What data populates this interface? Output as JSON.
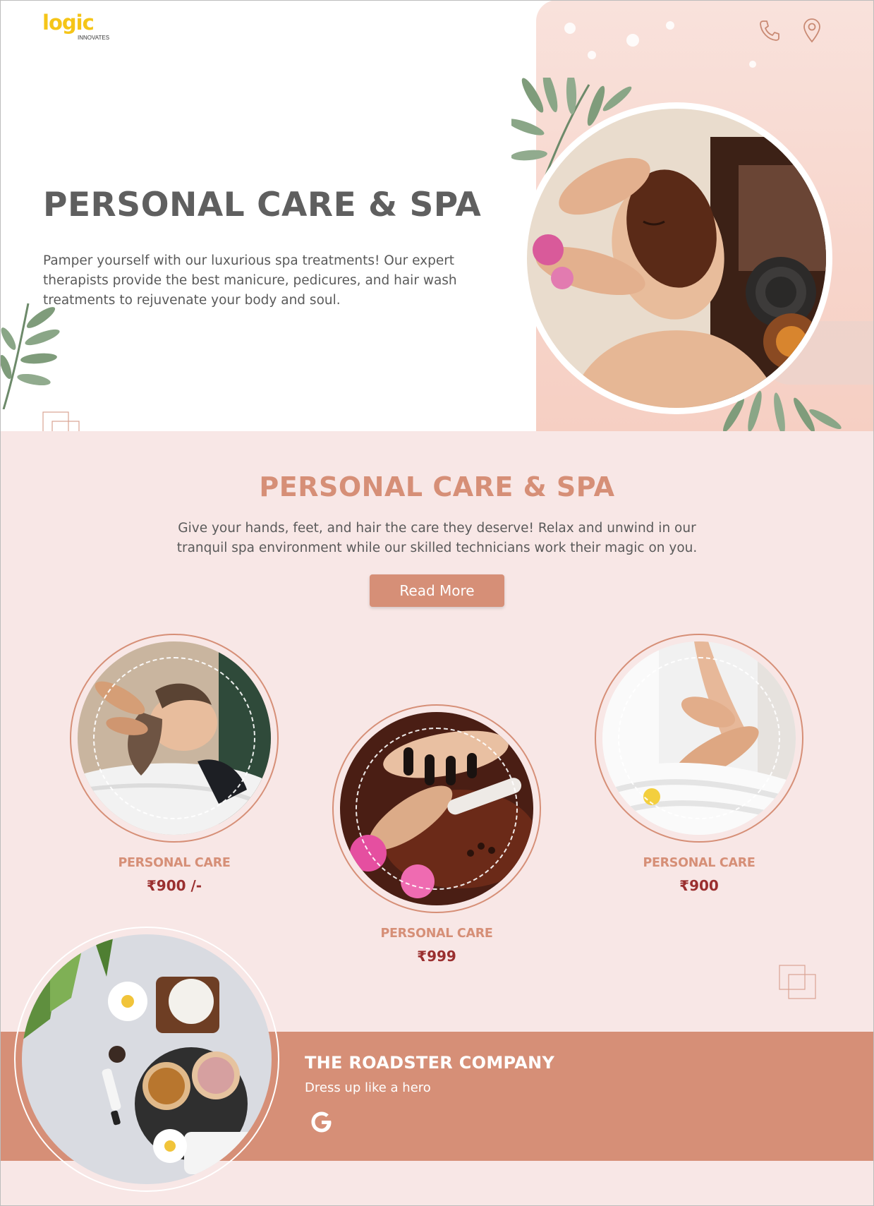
{
  "brand": {
    "logo_text": "logic",
    "logo_sub": "INNOVATES"
  },
  "header": {
    "phone_icon": "phone-icon",
    "location_icon": "map-pin-icon"
  },
  "hero": {
    "title": "PERSONAL CARE & SPA",
    "text": "Pamper yourself with our luxurious spa treatments! Our expert therapists provide the best manicure, pedicures, and hair wash treatments to rejuvenate your body and soul."
  },
  "services": {
    "title": "PERSONAL CARE & SPA",
    "text": "Give your hands, feet, and hair the care they deserve! Relax and unwind in our tranquil spa environment while our skilled technicians work their magic on you.",
    "button_label": "Read More",
    "cards": [
      {
        "label": "PERSONAL CARE",
        "price": "₹900 /-"
      },
      {
        "label": "PERSONAL CARE",
        "price": "₹999"
      },
      {
        "label": "PERSONAL CARE",
        "price": "₹900"
      }
    ]
  },
  "footer": {
    "title": "THE ROADSTER COMPANY",
    "subtitle": "Dress up like a hero",
    "social_icon": "google-icon"
  },
  "colors": {
    "accent": "#d68f77",
    "section_bg": "#f8e7e6",
    "price": "#9a2f2f",
    "logo": "#f5c518"
  }
}
